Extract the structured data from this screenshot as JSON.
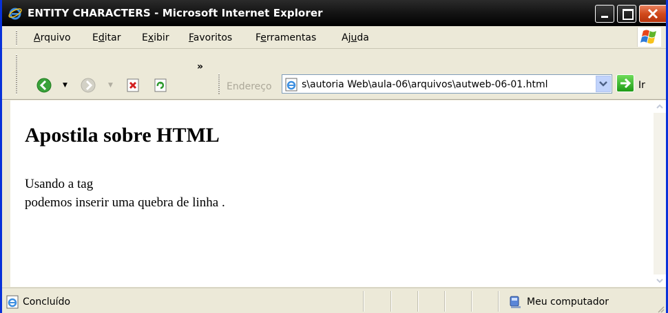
{
  "window": {
    "title": "ENTITY CHARACTERS - Microsoft Internet Explorer"
  },
  "menu": {
    "items": [
      {
        "access_key": "A",
        "rest": "rquivo"
      },
      {
        "pre": "E",
        "access_key": "d",
        "rest": "itar"
      },
      {
        "pre": "E",
        "access_key": "x",
        "rest": "ibir"
      },
      {
        "access_key": "F",
        "rest": "avoritos"
      },
      {
        "pre": "F",
        "access_key": "e",
        "rest": "rramentas"
      },
      {
        "pre": "Aj",
        "access_key": "u",
        "rest": "da"
      }
    ]
  },
  "toolbar": {
    "chevron": "»",
    "address_label": "Endereço",
    "address_value": "s\\autoria Web\\aula-06\\arquivos\\autweb-06-01.html",
    "go_label": "Ir"
  },
  "content": {
    "heading": "Apostila sobre HTML",
    "line1": "Usando a tag",
    "line2": "podemos inserir uma quebra de linha ."
  },
  "status": {
    "text": "Concluído",
    "zone": "Meu computador"
  }
}
